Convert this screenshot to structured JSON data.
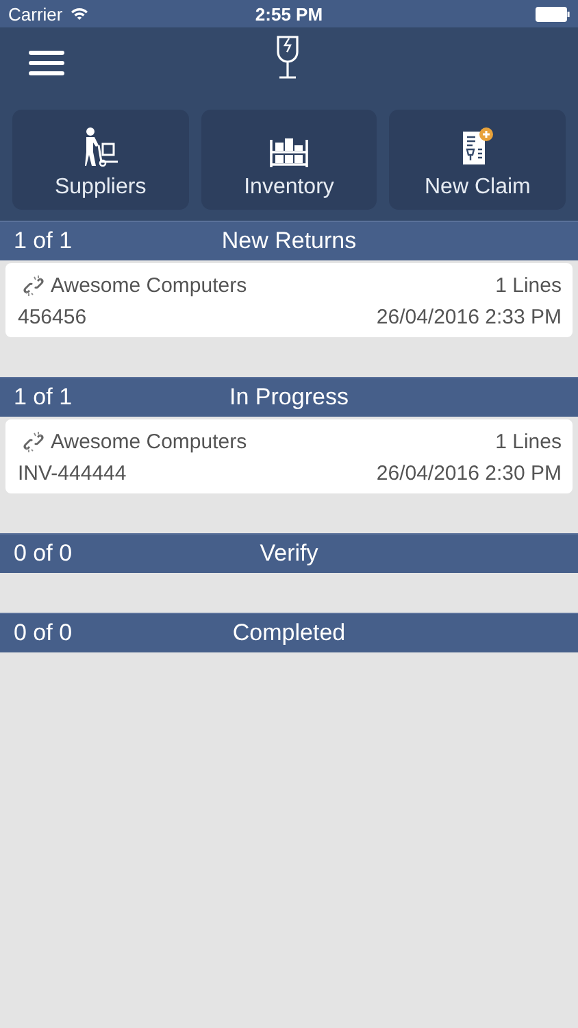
{
  "status_bar": {
    "carrier": "Carrier",
    "time": "2:55 PM"
  },
  "actions": [
    {
      "kind": "suppliers",
      "label": "Suppliers"
    },
    {
      "kind": "inventory",
      "label": "Inventory"
    },
    {
      "kind": "claim",
      "label": "New Claim"
    }
  ],
  "sections": [
    {
      "count": "1 of 1",
      "title": "New Returns",
      "items": [
        {
          "supplier": "Awesome Computers",
          "lines": "1 Lines",
          "reference": "456456",
          "date": "26/04/2016 2:33 PM"
        }
      ]
    },
    {
      "count": "1 of 1",
      "title": "In Progress",
      "items": [
        {
          "supplier": "Awesome Computers",
          "lines": "1 Lines",
          "reference": "INV-444444",
          "date": "26/04/2016 2:30 PM"
        }
      ]
    },
    {
      "count": "0 of 0",
      "title": "Verify"
    },
    {
      "count": "0 of 0",
      "title": "Completed"
    }
  ]
}
